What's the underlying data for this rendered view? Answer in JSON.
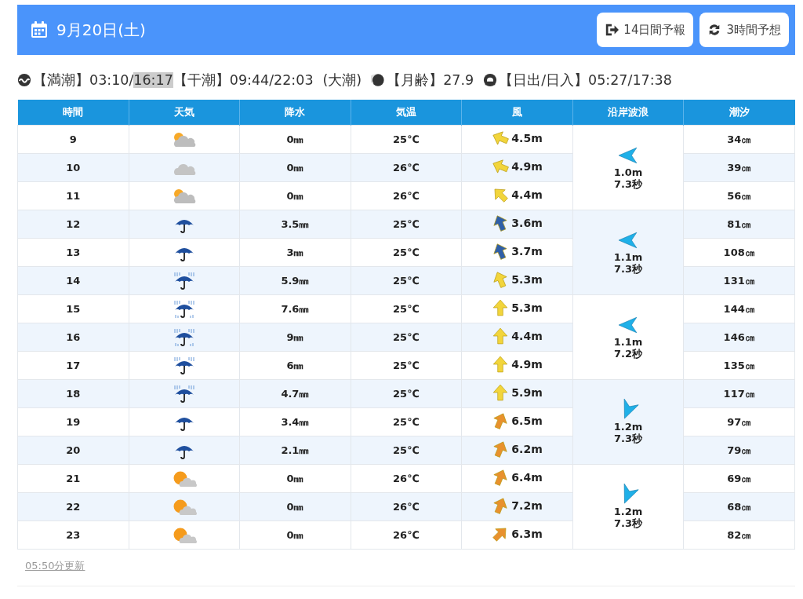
{
  "header": {
    "date": "9月20日(土)",
    "buttons": [
      {
        "label": "14日間予報",
        "kind": "exit"
      },
      {
        "label": "3時間予想",
        "kind": "swap"
      }
    ]
  },
  "tide_info": {
    "high_tide": {
      "label": "【満潮】",
      "times": [
        {
          "text": "03:10/",
          "highlighted": false
        },
        {
          "text": "16:17",
          "highlighted": true
        }
      ]
    },
    "low_tide": {
      "label": "【干潮】",
      "value": "09:44/22:03"
    },
    "tide_type": "(大潮)",
    "moon_age": {
      "label": "【月齢】",
      "value": "27.9"
    },
    "sun": {
      "label": "【日出/日入】",
      "value": "05:27/17:38"
    }
  },
  "table": {
    "columns": [
      "時間",
      "天気",
      "降水",
      "気温",
      "風",
      "沿岸波浪",
      "潮汐"
    ],
    "rows": [
      {
        "hour": "9",
        "weather": {
          "kind": "cloudsun"
        },
        "rain": "0㎜",
        "temp": "25℃",
        "wind": {
          "kind": "wnw",
          "color": "#f2d53c",
          "speed": "4.5m"
        },
        "tide": "34㎝"
      },
      {
        "hour": "10",
        "weather": {
          "kind": "cloud"
        },
        "rain": "0㎜",
        "temp": "26℃",
        "wind": {
          "kind": "wnw",
          "color": "#f2d53c",
          "speed": "4.9m"
        },
        "tide": "39㎝"
      },
      {
        "hour": "11",
        "weather": {
          "kind": "cloudsun"
        },
        "rain": "0㎜",
        "temp": "26℃",
        "wind": {
          "kind": "nw",
          "color": "#f2d53c",
          "speed": "4.4m"
        },
        "tide": "56㎝"
      },
      {
        "hour": "12",
        "weather": {
          "kind": "umbrella"
        },
        "rain": "3.5㎜",
        "temp": "25℃",
        "wind": {
          "kind": "nnw",
          "color": "#2f5fa8",
          "speed": "3.6m"
        },
        "tide": "81㎝"
      },
      {
        "hour": "13",
        "weather": {
          "kind": "umbrella"
        },
        "rain": "3㎜",
        "temp": "25℃",
        "wind": {
          "kind": "nnw",
          "color": "#2f5fa8",
          "speed": "3.7m"
        },
        "tide": "108㎝"
      },
      {
        "hour": "14",
        "weather": {
          "kind": "rain"
        },
        "rain": "5.9㎜",
        "temp": "25℃",
        "wind": {
          "kind": "nnw",
          "color": "#f2d53c",
          "speed": "5.3m"
        },
        "tide": "131㎝"
      },
      {
        "hour": "15",
        "weather": {
          "kind": "heavyrain"
        },
        "rain": "7.6㎜",
        "temp": "25℃",
        "wind": {
          "kind": "n",
          "color": "#f2d53c",
          "speed": "5.3m"
        },
        "tide": "144㎝"
      },
      {
        "hour": "16",
        "weather": {
          "kind": "heavyrain"
        },
        "rain": "9㎜",
        "temp": "25℃",
        "wind": {
          "kind": "n",
          "color": "#f2d53c",
          "speed": "4.4m"
        },
        "tide": "146㎝"
      },
      {
        "hour": "17",
        "weather": {
          "kind": "rain"
        },
        "rain": "6㎜",
        "temp": "25℃",
        "wind": {
          "kind": "n",
          "color": "#f2d53c",
          "speed": "4.9m"
        },
        "tide": "135㎝"
      },
      {
        "hour": "18",
        "weather": {
          "kind": "rain"
        },
        "rain": "4.7㎜",
        "temp": "25℃",
        "wind": {
          "kind": "n",
          "color": "#f2d53c",
          "speed": "5.9m"
        },
        "tide": "117㎝"
      },
      {
        "hour": "19",
        "weather": {
          "kind": "umbrella"
        },
        "rain": "3.4㎜",
        "temp": "25℃",
        "wind": {
          "kind": "nne",
          "color": "#e8912e",
          "speed": "6.5m"
        },
        "tide": "97㎝"
      },
      {
        "hour": "20",
        "weather": {
          "kind": "umbrella"
        },
        "rain": "2.1㎜",
        "temp": "25℃",
        "wind": {
          "kind": "nne",
          "color": "#e8912e",
          "speed": "6.2m"
        },
        "tide": "79㎝"
      },
      {
        "hour": "21",
        "weather": {
          "kind": "suncloud"
        },
        "rain": "0㎜",
        "temp": "26℃",
        "wind": {
          "kind": "nne",
          "color": "#e8912e",
          "speed": "6.4m"
        },
        "tide": "69㎝"
      },
      {
        "hour": "22",
        "weather": {
          "kind": "suncloud"
        },
        "rain": "0㎜",
        "temp": "26℃",
        "wind": {
          "kind": "nne",
          "color": "#e8912e",
          "speed": "7.2m"
        },
        "tide": "68㎝"
      },
      {
        "hour": "23",
        "weather": {
          "kind": "suncloud"
        },
        "rain": "0㎜",
        "temp": "26℃",
        "wind": {
          "kind": "ne",
          "color": "#e8912e",
          "speed": "6.3m"
        },
        "tide": "82㎝"
      }
    ],
    "waves": [
      {
        "kind": "w",
        "height": "1.0m",
        "period": "7.3秒"
      },
      {
        "kind": "w",
        "height": "1.1m",
        "period": "7.3秒"
      },
      {
        "kind": "w",
        "height": "1.1m",
        "period": "7.2秒"
      },
      {
        "kind": "ssw",
        "height": "1.2m",
        "period": "7.3秒"
      },
      {
        "kind": "ssw",
        "height": "1.2m",
        "period": "7.3秒"
      }
    ]
  },
  "footer": {
    "updated": "05:50分更新"
  }
}
